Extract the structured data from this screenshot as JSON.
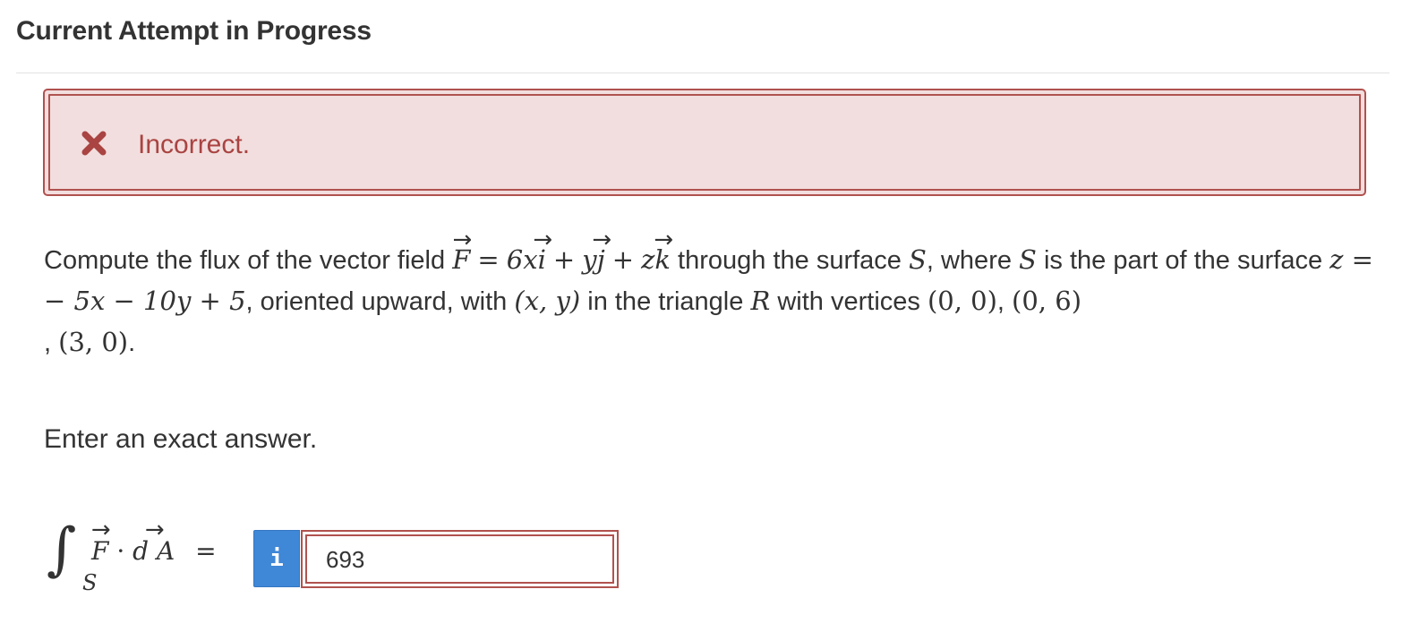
{
  "header": {
    "title": "Current Attempt in Progress"
  },
  "alert": {
    "icon": "close-x-icon",
    "message": "Incorrect.",
    "border_color": "#b0524f",
    "bg_color": "#f2dede",
    "text_color": "#a94442"
  },
  "question": {
    "intro": "Compute the flux of the vector field",
    "field_F": "F",
    "eq": "=",
    "coef_x": "6x",
    "i": "i",
    "plus1": "+",
    "y": "y",
    "j": "j",
    "plus2": "+",
    "z": "z",
    "k": "k",
    "mid1": "through the surface",
    "S1": "S",
    "mid2": ", where",
    "S2": "S",
    "mid3": "is the part of the surface",
    "zeq": "z =",
    "surface_rhs": "− 5x − 10y + 5",
    "mid4": ", oriented upward, with",
    "xy": "(x, y)",
    "mid5": "in the triangle",
    "R": "R",
    "mid6": "with vertices",
    "v1": "(0, 0)",
    "v2": "(0, 6)",
    "v3": "(3, 0)"
  },
  "instruction": "Enter an exact answer.",
  "integral": {
    "sign": "∫",
    "sub": "S",
    "F": "F",
    "dot": "·",
    "dA": "d A",
    "eq": "="
  },
  "answer": {
    "info_label": "i",
    "value": "693",
    "info_color": "#3f87d7"
  }
}
